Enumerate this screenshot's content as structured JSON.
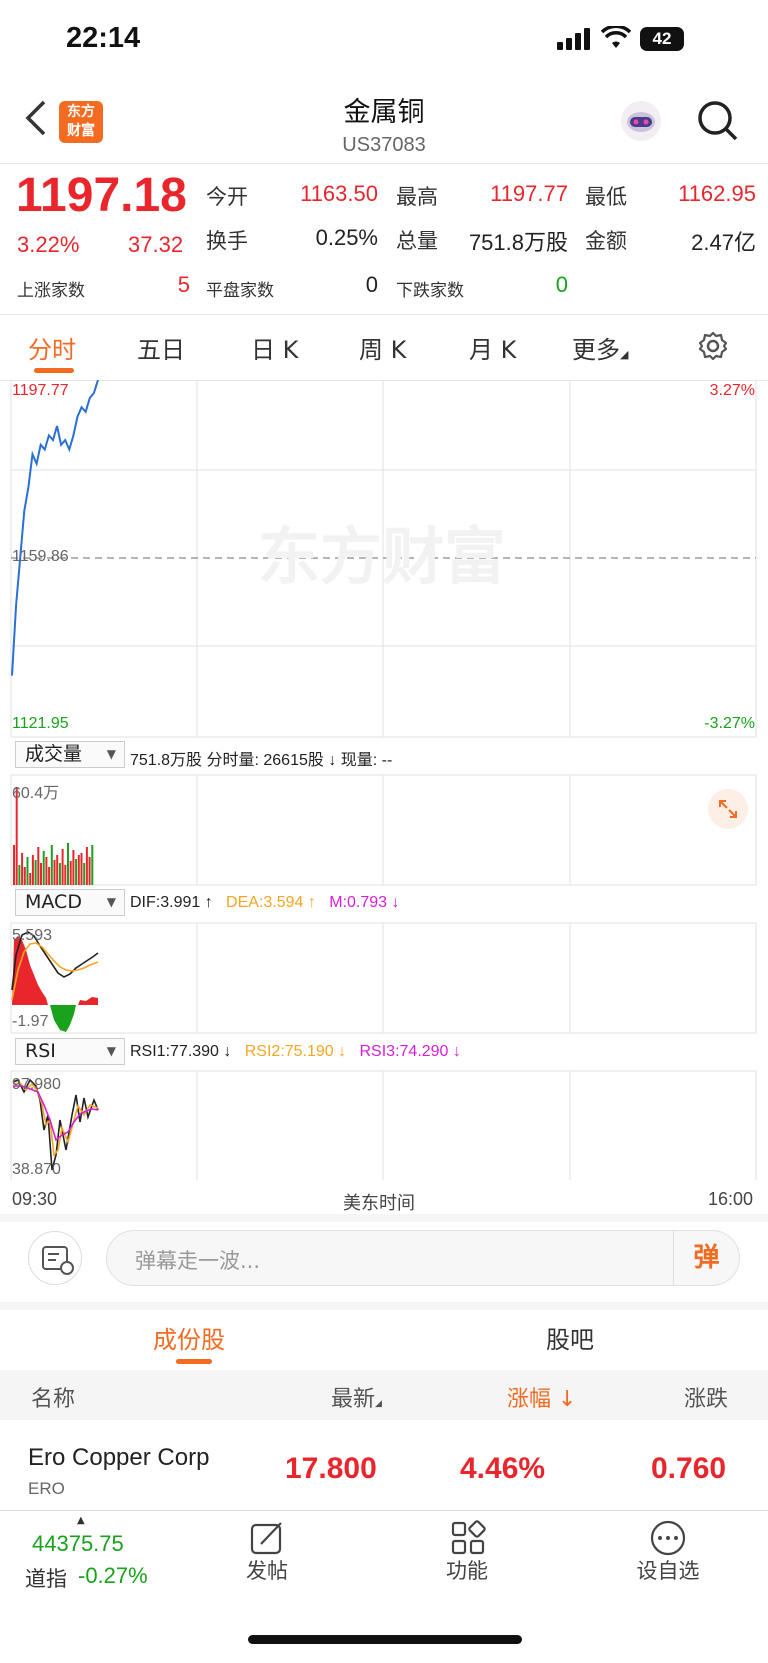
{
  "status": {
    "time": "22:14",
    "battery": "42"
  },
  "header": {
    "back_icon": "chevron-left-icon",
    "logo_text_1": "东方",
    "logo_text_2": "财富",
    "title": "金属铜",
    "code": "US37083",
    "robot_icon": "robot-avatar-icon",
    "search_icon": "search-icon"
  },
  "quote": {
    "price": "1197.18",
    "change_pct": "3.22%",
    "change": "37.32",
    "open_label": "今开",
    "open": "1163.50",
    "high_label": "最高",
    "high": "1197.77",
    "low_label": "最低",
    "low": "1162.95",
    "turnover_label": "换手",
    "turnover": "0.25%",
    "volume_label": "总量",
    "volume": "751.8万股",
    "amount_label": "金额",
    "amount": "2.47亿",
    "up_label": "上涨家数",
    "up": "5",
    "flat_label": "平盘家数",
    "flat": "0",
    "down_label": "下跌家数",
    "down": "0"
  },
  "tabs": [
    "分时",
    "五日",
    "日 K",
    "周 K",
    "月 K",
    "更多"
  ],
  "active_tab": "分时",
  "chart": {
    "price_high": "1197.77",
    "price_mid": "1159.86",
    "price_low": "1121.95",
    "pct_high": "3.27%",
    "pct_low": "-3.27%",
    "watermark": "东方财富",
    "time_start": "09:30",
    "time_label": "美东时间",
    "time_end": "16:00",
    "price_series": [
      1135,
      1150,
      1160,
      1170,
      1175,
      1182,
      1180,
      1184,
      1183,
      1186,
      1185,
      1188,
      1184,
      1185,
      1183,
      1186,
      1190,
      1192,
      1191,
      1194,
      1195,
      1197.77
    ]
  },
  "volume": {
    "selector": "成交量",
    "line": "751.8万股  分时量: 26615股 ↓  现量: --",
    "max_label": "60.4万"
  },
  "macd": {
    "selector": "MACD",
    "dif": "DIF:3.991 ↑",
    "dea": "DEA:3.594 ↑",
    "m": "M:0.793 ↓",
    "max_label": "5.593",
    "min_label": "-1.97"
  },
  "rsi": {
    "selector": "RSI",
    "rsi1": "RSI1:77.390 ↓",
    "rsi2": "RSI2:75.190 ↓",
    "rsi3": "RSI3:74.290 ↓",
    "max_label": "97.980",
    "min_label": "38.870"
  },
  "comment": {
    "placeholder": "弹幕走一波...",
    "danmu_label": "弹"
  },
  "section_tabs": [
    "成份股",
    "股吧"
  ],
  "table": {
    "headers": [
      "名称",
      "最新",
      "涨幅",
      "涨跌"
    ],
    "rows": [
      {
        "name": "Ero Copper Corp",
        "code": "ERO",
        "last": "17.800",
        "pct": "4.46%",
        "change": "0.760"
      }
    ]
  },
  "bottom": {
    "index_value": "44375.75",
    "index_name": "道指",
    "index_pct": "-0.27%",
    "post": "发帖",
    "func": "功能",
    "fav": "设自选"
  },
  "colors": {
    "up": "#e8262c",
    "down": "#19a21c",
    "accent": "#f36a21",
    "line": "#2a6fd6"
  }
}
